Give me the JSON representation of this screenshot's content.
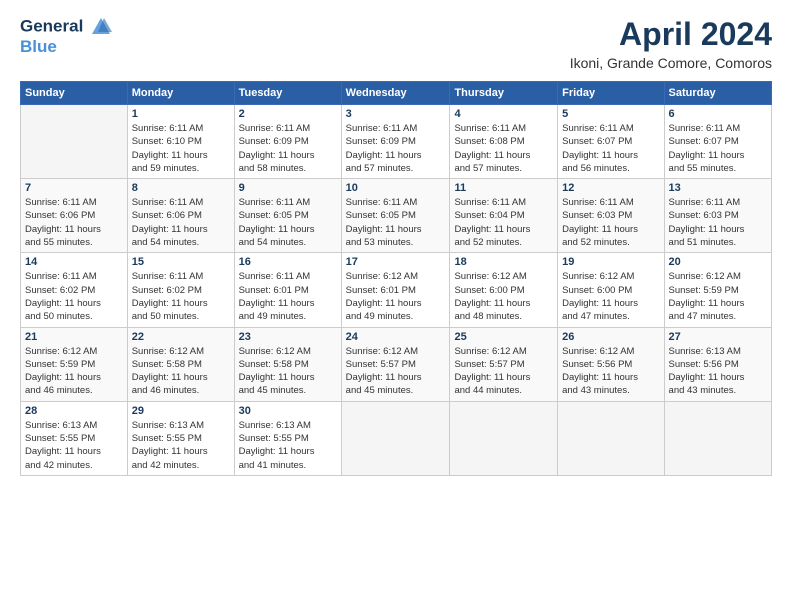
{
  "header": {
    "logo_line1": "General",
    "logo_line2": "Blue",
    "title": "April 2024",
    "location": "Ikoni, Grande Comore, Comoros"
  },
  "days_of_week": [
    "Sunday",
    "Monday",
    "Tuesday",
    "Wednesday",
    "Thursday",
    "Friday",
    "Saturday"
  ],
  "weeks": [
    [
      {
        "day": "",
        "info": ""
      },
      {
        "day": "1",
        "info": "Sunrise: 6:11 AM\nSunset: 6:10 PM\nDaylight: 11 hours\nand 59 minutes."
      },
      {
        "day": "2",
        "info": "Sunrise: 6:11 AM\nSunset: 6:09 PM\nDaylight: 11 hours\nand 58 minutes."
      },
      {
        "day": "3",
        "info": "Sunrise: 6:11 AM\nSunset: 6:09 PM\nDaylight: 11 hours\nand 57 minutes."
      },
      {
        "day": "4",
        "info": "Sunrise: 6:11 AM\nSunset: 6:08 PM\nDaylight: 11 hours\nand 57 minutes."
      },
      {
        "day": "5",
        "info": "Sunrise: 6:11 AM\nSunset: 6:07 PM\nDaylight: 11 hours\nand 56 minutes."
      },
      {
        "day": "6",
        "info": "Sunrise: 6:11 AM\nSunset: 6:07 PM\nDaylight: 11 hours\nand 55 minutes."
      }
    ],
    [
      {
        "day": "7",
        "info": "Sunrise: 6:11 AM\nSunset: 6:06 PM\nDaylight: 11 hours\nand 55 minutes."
      },
      {
        "day": "8",
        "info": "Sunrise: 6:11 AM\nSunset: 6:06 PM\nDaylight: 11 hours\nand 54 minutes."
      },
      {
        "day": "9",
        "info": "Sunrise: 6:11 AM\nSunset: 6:05 PM\nDaylight: 11 hours\nand 54 minutes."
      },
      {
        "day": "10",
        "info": "Sunrise: 6:11 AM\nSunset: 6:05 PM\nDaylight: 11 hours\nand 53 minutes."
      },
      {
        "day": "11",
        "info": "Sunrise: 6:11 AM\nSunset: 6:04 PM\nDaylight: 11 hours\nand 52 minutes."
      },
      {
        "day": "12",
        "info": "Sunrise: 6:11 AM\nSunset: 6:03 PM\nDaylight: 11 hours\nand 52 minutes."
      },
      {
        "day": "13",
        "info": "Sunrise: 6:11 AM\nSunset: 6:03 PM\nDaylight: 11 hours\nand 51 minutes."
      }
    ],
    [
      {
        "day": "14",
        "info": "Sunrise: 6:11 AM\nSunset: 6:02 PM\nDaylight: 11 hours\nand 50 minutes."
      },
      {
        "day": "15",
        "info": "Sunrise: 6:11 AM\nSunset: 6:02 PM\nDaylight: 11 hours\nand 50 minutes."
      },
      {
        "day": "16",
        "info": "Sunrise: 6:11 AM\nSunset: 6:01 PM\nDaylight: 11 hours\nand 49 minutes."
      },
      {
        "day": "17",
        "info": "Sunrise: 6:12 AM\nSunset: 6:01 PM\nDaylight: 11 hours\nand 49 minutes."
      },
      {
        "day": "18",
        "info": "Sunrise: 6:12 AM\nSunset: 6:00 PM\nDaylight: 11 hours\nand 48 minutes."
      },
      {
        "day": "19",
        "info": "Sunrise: 6:12 AM\nSunset: 6:00 PM\nDaylight: 11 hours\nand 47 minutes."
      },
      {
        "day": "20",
        "info": "Sunrise: 6:12 AM\nSunset: 5:59 PM\nDaylight: 11 hours\nand 47 minutes."
      }
    ],
    [
      {
        "day": "21",
        "info": "Sunrise: 6:12 AM\nSunset: 5:59 PM\nDaylight: 11 hours\nand 46 minutes."
      },
      {
        "day": "22",
        "info": "Sunrise: 6:12 AM\nSunset: 5:58 PM\nDaylight: 11 hours\nand 46 minutes."
      },
      {
        "day": "23",
        "info": "Sunrise: 6:12 AM\nSunset: 5:58 PM\nDaylight: 11 hours\nand 45 minutes."
      },
      {
        "day": "24",
        "info": "Sunrise: 6:12 AM\nSunset: 5:57 PM\nDaylight: 11 hours\nand 45 minutes."
      },
      {
        "day": "25",
        "info": "Sunrise: 6:12 AM\nSunset: 5:57 PM\nDaylight: 11 hours\nand 44 minutes."
      },
      {
        "day": "26",
        "info": "Sunrise: 6:12 AM\nSunset: 5:56 PM\nDaylight: 11 hours\nand 43 minutes."
      },
      {
        "day": "27",
        "info": "Sunrise: 6:13 AM\nSunset: 5:56 PM\nDaylight: 11 hours\nand 43 minutes."
      }
    ],
    [
      {
        "day": "28",
        "info": "Sunrise: 6:13 AM\nSunset: 5:55 PM\nDaylight: 11 hours\nand 42 minutes."
      },
      {
        "day": "29",
        "info": "Sunrise: 6:13 AM\nSunset: 5:55 PM\nDaylight: 11 hours\nand 42 minutes."
      },
      {
        "day": "30",
        "info": "Sunrise: 6:13 AM\nSunset: 5:55 PM\nDaylight: 11 hours\nand 41 minutes."
      },
      {
        "day": "",
        "info": ""
      },
      {
        "day": "",
        "info": ""
      },
      {
        "day": "",
        "info": ""
      },
      {
        "day": "",
        "info": ""
      }
    ]
  ]
}
